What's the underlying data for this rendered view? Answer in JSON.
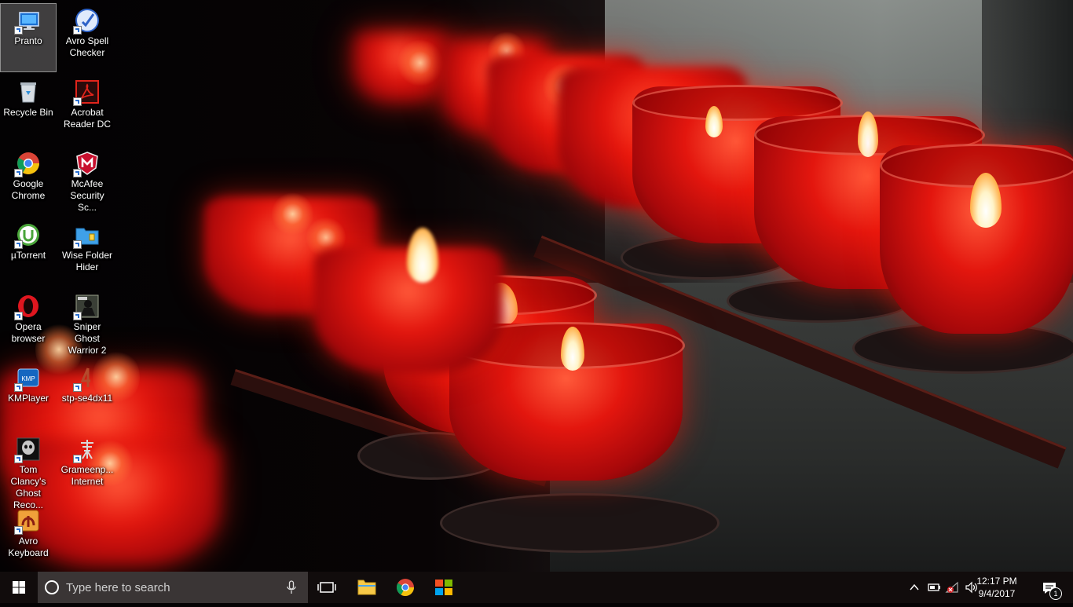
{
  "desktop": {
    "icons": [
      {
        "label": "Pranto",
        "icon": "computer-monitor-icon"
      },
      {
        "label": "Avro Spell Checker",
        "icon": "avro-spell-checker-icon"
      },
      {
        "label": "Recycle Bin",
        "icon": "recycle-bin-icon"
      },
      {
        "label": "Acrobat Reader DC",
        "icon": "acrobat-reader-icon"
      },
      {
        "label": "Google Chrome",
        "icon": "chrome-icon"
      },
      {
        "label": "McAfee Security Sc...",
        "icon": "mcafee-icon"
      },
      {
        "label": "µTorrent",
        "icon": "utorrent-icon"
      },
      {
        "label": "Wise Folder Hider",
        "icon": "wise-folder-hider-icon"
      },
      {
        "label": "Opera browser",
        "icon": "opera-icon"
      },
      {
        "label": "Sniper Ghost Warrior 2",
        "icon": "sniper-ghost-warrior-icon"
      },
      {
        "label": "KMPlayer",
        "icon": "kmplayer-icon"
      },
      {
        "label": "stp-se4dx11",
        "icon": "stp-file-icon"
      },
      {
        "label": "Tom Clancy's Ghost Reco...",
        "icon": "ghost-recon-icon"
      },
      {
        "label": "Grameenp... Internet",
        "icon": "grameenphone-internet-icon"
      },
      {
        "label": "Avro Keyboard",
        "icon": "avro-keyboard-icon"
      }
    ]
  },
  "taskbar": {
    "search_placeholder": "Type here to search",
    "pinned": [
      "task-view-icon",
      "file-explorer-icon",
      "chrome-icon",
      "windows-store-icon"
    ],
    "clock": {
      "time": "12:17 PM",
      "date": "9/4/2017"
    },
    "notifications_count": "1"
  },
  "colors": {
    "taskbar_bg": "#120c0c",
    "search_bg": "#3a3535",
    "accent": "#2a6fcf"
  }
}
